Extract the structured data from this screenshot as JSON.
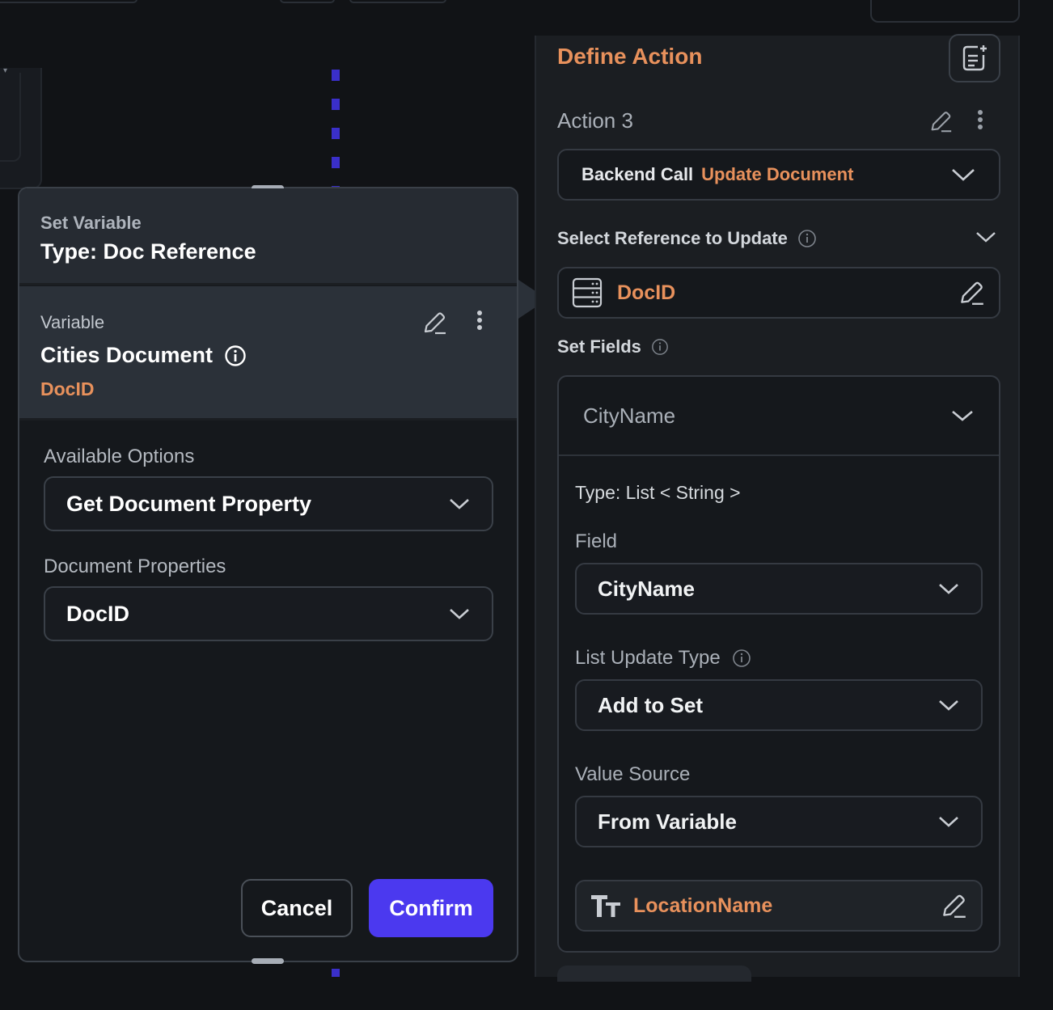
{
  "modal": {
    "header_sub": "Set Variable",
    "header_title": "Type: Doc Reference",
    "variable_label": "Variable",
    "variable_name": "Cities Document",
    "variable_property": "DocID",
    "available_options_label": "Available Options",
    "available_options_value": "Get Document Property",
    "document_properties_label": "Document Properties",
    "document_properties_value": "DocID",
    "cancel_label": "Cancel",
    "confirm_label": "Confirm"
  },
  "panel": {
    "title": "Define Action",
    "action_name": "Action 3",
    "backend_call_label": "Backend Call",
    "backend_call_value": "Update Document",
    "select_reference_label": "Select Reference to Update",
    "reference_value": "DocID",
    "set_fields_label": "Set Fields",
    "field_group": {
      "header": "CityName",
      "type_text": "Type: List < String >",
      "field_label": "Field",
      "field_value": "CityName",
      "list_update_type_label": "List Update Type",
      "list_update_type_value": "Add to Set",
      "value_source_label": "Value Source",
      "value_source_value": "From Variable",
      "variable_value": "LocationName"
    }
  },
  "colors": {
    "accent_orange": "#e8915c",
    "primary_button": "#4b39ef",
    "dashed_connector": "#3a2fc9"
  }
}
